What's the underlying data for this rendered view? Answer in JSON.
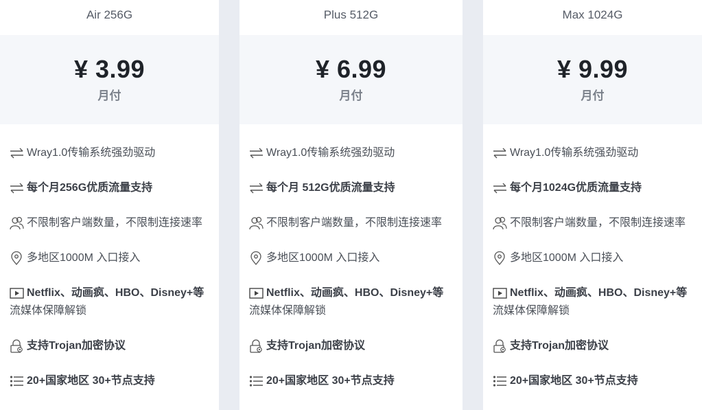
{
  "plans": [
    {
      "name": "Air 256G",
      "price": "¥ 3.99",
      "period": "月付",
      "features": {
        "driver": "Wray1.0传输系统强劲驱动",
        "traffic": "每个月256G优质流量支持",
        "clients": "不限制客户端数量，不限制连接速率",
        "entry": "多地区1000M 入口接入",
        "stream_l1": "Netflix、动画疯、HBO、Disney+等",
        "stream_l2": "流媒体保障解锁",
        "trojan": "支持Trojan加密协议",
        "nodes": "20+国家地区 30+节点支持"
      }
    },
    {
      "name": "Plus 512G",
      "price": "¥ 6.99",
      "period": "月付",
      "features": {
        "driver": "Wray1.0传输系统强劲驱动",
        "traffic": "每个月 512G优质流量支持",
        "clients": "不限制客户端数量，不限制连接速率",
        "entry": "多地区1000M 入口接入",
        "stream_l1": "Netflix、动画疯、HBO、Disney+等",
        "stream_l2": "流媒体保障解锁",
        "trojan": "支持Trojan加密协议",
        "nodes": "20+国家地区 30+节点支持"
      }
    },
    {
      "name": "Max 1024G",
      "price": "¥ 9.99",
      "period": "月付",
      "features": {
        "driver": "Wray1.0传输系统强劲驱动",
        "traffic": "每个月1024G优质流量支持",
        "clients": "不限制客户端数量，不限制连接速率",
        "entry": "多地区1000M 入口接入",
        "stream_l1": "Netflix、动画疯、HBO、Disney+等",
        "stream_l2": "流媒体保障解锁",
        "trojan": "支持Trojan加密协议",
        "nodes": "20+国家地区 30+节点支持"
      }
    }
  ],
  "icons": {
    "driver": "transfer-arrows-icon",
    "traffic": "transfer-arrows-icon",
    "clients": "users-icon",
    "entry": "location-pin-icon",
    "stream": "video-play-icon",
    "trojan": "lock-icon",
    "nodes": "list-icon"
  },
  "colors": {
    "page_background": "#e9ecf2",
    "card_background": "#ffffff",
    "price_box_background": "#f5f7fa",
    "price_text": "#1f2329",
    "feature_text": "#4a4f57"
  }
}
